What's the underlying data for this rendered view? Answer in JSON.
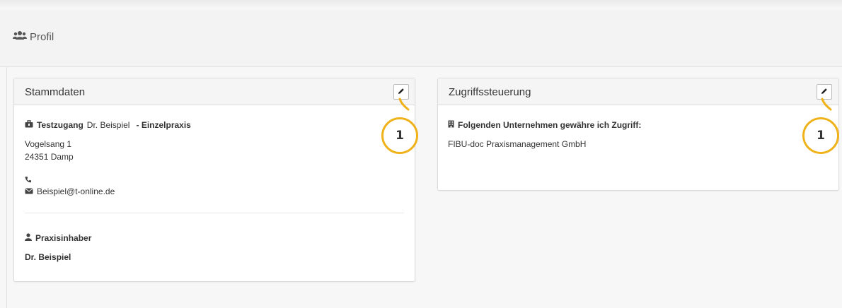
{
  "page": {
    "title": "Profil"
  },
  "stammdaten": {
    "title": "Stammdaten",
    "practice_prefix": "Testzugang",
    "practice_name": "Dr. Beispiel",
    "practice_suffix": "- Einzelpraxis",
    "street": "Vogelsang 1",
    "city": "24351 Damp",
    "phone": "",
    "email": "Beispiel@t-online.de",
    "owner_heading": "Praxisinhaber",
    "owner_name": "Dr. Beispiel"
  },
  "zugriff": {
    "title": "Zugriffssteuerung",
    "heading": "Folgenden Unternehmen gewähre ich Zugriff:",
    "company": "FIBU-doc Praxismanagement GmbH"
  },
  "callouts": [
    "1",
    "1"
  ],
  "colors": {
    "callout": "#f0b21a",
    "card_header": "#f5f5f5",
    "border": "#dcdcdc"
  },
  "icons": [
    "users-icon",
    "pencil-icon",
    "briefcase-icon",
    "phone-icon",
    "envelope-icon",
    "user-icon",
    "building-icon"
  ]
}
